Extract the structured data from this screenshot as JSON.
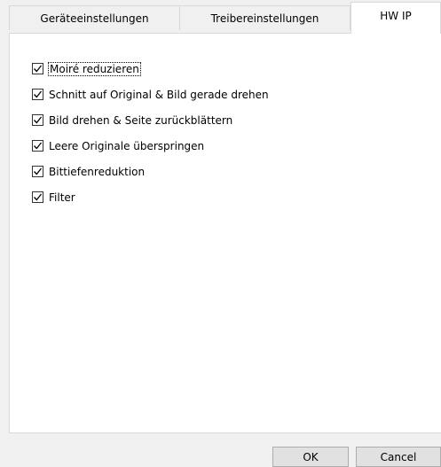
{
  "tabs": [
    {
      "label": "Geräteeinstellungen",
      "active": false
    },
    {
      "label": "Treibereinstellungen",
      "active": false
    },
    {
      "label": "HW IP",
      "active": true
    }
  ],
  "options": [
    {
      "label": "Moiré reduzieren",
      "checked": true,
      "focused": true
    },
    {
      "label": "Schnitt auf Original & Bild gerade drehen",
      "checked": true
    },
    {
      "label": "Bild drehen & Seite zurückblättern",
      "checked": true
    },
    {
      "label": "Leere Originale überspringen",
      "checked": true
    },
    {
      "label": "Bittiefenreduktion",
      "checked": true
    },
    {
      "label": "Filter",
      "checked": true
    }
  ],
  "buttons": {
    "ok_label": "OK",
    "cancel_label": "Cancel"
  },
  "icons": {
    "checkbox_check": "check-icon"
  },
  "colors": {
    "panel_bg": "#ffffff",
    "dialog_bg": "#f0f0f0",
    "border": "#d9d9d9",
    "button_bg": "#e1e1e1"
  }
}
